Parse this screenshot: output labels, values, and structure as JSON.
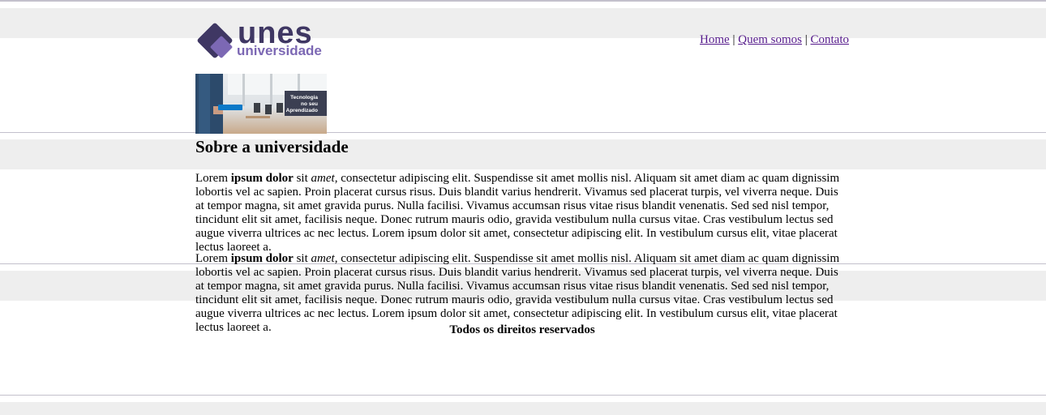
{
  "header": {
    "logo": {
      "main_text": "unes",
      "sub_text": "universidade"
    },
    "nav": {
      "items": [
        {
          "label": "Home"
        },
        {
          "label": "Quem somos"
        },
        {
          "label": "Contato"
        }
      ],
      "separator": "|"
    }
  },
  "banner": {
    "caption_line1": "Tecnologia",
    "caption_line2": "no seu",
    "caption_line3": "Aprendizado"
  },
  "main": {
    "title": "Sobre a universidade",
    "paragraphs": [
      {
        "lead": "Lorem ",
        "bold": "ipsum dolor",
        "mid": " sit ",
        "italic": "amet",
        "rest": ", consectetur adipiscing elit. Suspendisse sit amet mollis nisl. Aliquam sit amet diam ac quam dignissim lobortis vel ac sapien. Proin placerat cursus risus. Duis blandit varius hendrerit. Vivamus sed placerat turpis, vel viverra neque. Duis at tempor magna, sit amet gravida purus. Nulla facilisi. Vivamus accumsan risus vitae risus blandit venenatis. Sed sed nisl tempor, tincidunt elit sit amet, facilisis neque. Donec rutrum mauris odio, gravida vestibulum nulla cursus vitae. Cras vestibulum lectus sed augue viverra ultrices ac nec lectus. Lorem ipsum dolor sit amet, consectetur adipiscing elit. In vestibulum cursus elit, vitae placerat lectus laoreet a."
      },
      {
        "lead": "Lorem ",
        "bold": "ipsum dolor",
        "mid": " sit ",
        "italic": "amet",
        "rest": ", consectetur adipiscing elit. Suspendisse sit amet mollis nisl. Aliquam sit amet diam ac quam dignissim lobortis vel ac sapien. Proin placerat cursus risus. Duis blandit varius hendrerit. Vivamus sed placerat turpis, vel viverra neque. Duis at tempor magna, sit amet gravida purus. Nulla facilisi. Vivamus accumsan risus vitae risus blandit venenatis. Sed sed nisl tempor, tincidunt elit sit amet, facilisis neque. Donec rutrum mauris odio, gravida vestibulum nulla cursus vitae. Cras vestibulum lectus sed augue viverra ultrices ac nec lectus. Lorem ipsum dolor sit amet, consectetur adipiscing elit. In vestibulum cursus elit, vitae placerat lectus laoreet a."
      }
    ]
  },
  "footer": {
    "text": "Todos os direitos reservados"
  },
  "colors": {
    "link": "#551a8b",
    "logo_dark": "#3f3763",
    "logo_light": "#7c68b4",
    "stripe_gray": "#eeeeee",
    "stripe_line": "#c3c0cc"
  }
}
